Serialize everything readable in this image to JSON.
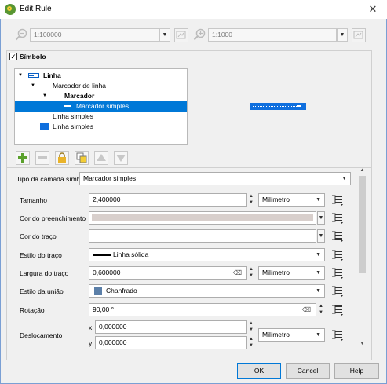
{
  "window": {
    "title": "Edit Rule",
    "close": "✕"
  },
  "scale": {
    "min_value": "1:100000",
    "max_value": "1:1000"
  },
  "symbol_group": {
    "title": "Símbolo",
    "checked": true
  },
  "tree": [
    {
      "label": "Linha",
      "bold": true
    },
    {
      "label": "Marcador de linha",
      "bold": false
    },
    {
      "label": "Marcador",
      "bold": true
    },
    {
      "label": "Marcador simples",
      "bold": false,
      "selected": true
    },
    {
      "label": "Linha simples",
      "bold": false
    },
    {
      "label": "Linha simples",
      "bold": false
    }
  ],
  "layer_type": {
    "label": "Tipo da camada símbolo",
    "value": "Marcador simples"
  },
  "properties": {
    "size": {
      "label": "Tamanho",
      "value": "2,400000",
      "unit": "Milímetro"
    },
    "fill_color": {
      "label": "Cor do preenchimento",
      "color": "#d8cfcc"
    },
    "stroke_color": {
      "label": "Cor do traço",
      "color": "#ffffff"
    },
    "stroke_style": {
      "label": "Estilo do traço",
      "value": "Linha sólida"
    },
    "stroke_width": {
      "label": "Largura do traço",
      "value": "0,600000",
      "unit": "Milímetro"
    },
    "join_style": {
      "label": "Estilo da união",
      "value": "Chanfrado"
    },
    "rotation": {
      "label": "Rotação",
      "value": "90,00 °"
    },
    "offset": {
      "label": "Deslocamento",
      "x_label": "x",
      "x_value": "0,000000",
      "y_label": "y",
      "y_value": "0,000000",
      "unit": "Milímetro"
    }
  },
  "buttons": {
    "ok": "OK",
    "cancel": "Cancel",
    "help": "Help"
  },
  "colors": {
    "accent": "#0078d7",
    "preview_line": "#0f6fde"
  }
}
